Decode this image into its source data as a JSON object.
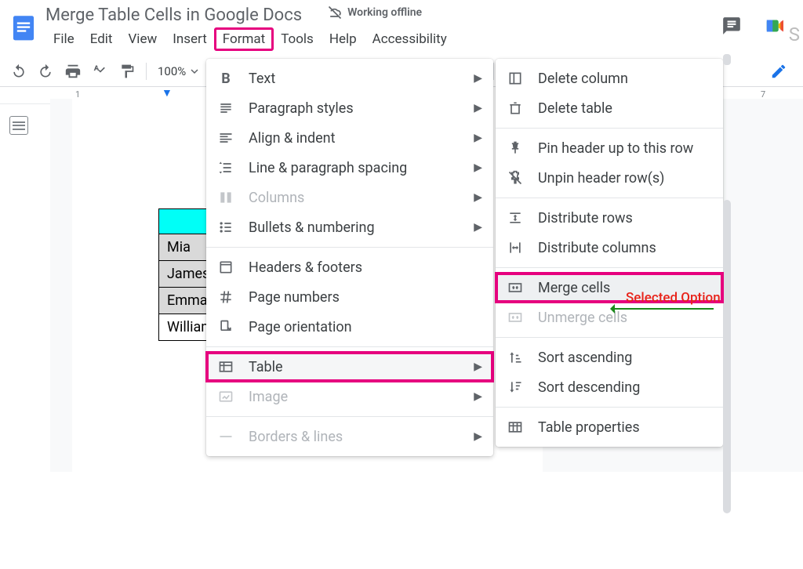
{
  "header": {
    "doc_title": "Merge Table Cells in Google Docs",
    "offline_label": "Working offline"
  },
  "menubar": [
    "File",
    "Edit",
    "View",
    "Insert",
    "Format",
    "Tools",
    "Help",
    "Accessibility"
  ],
  "toolbar": {
    "zoom": "100%"
  },
  "ruler": {
    "ticks": [
      "1",
      "7"
    ]
  },
  "doc_table": {
    "rows": [
      "Mia",
      "James",
      "Emma",
      "William"
    ]
  },
  "format_menu": {
    "items": [
      {
        "icon": "B",
        "label": "Text",
        "sub": true
      },
      {
        "icon": "para",
        "label": "Paragraph styles",
        "sub": true
      },
      {
        "icon": "align",
        "label": "Align & indent",
        "sub": true
      },
      {
        "icon": "spacing",
        "label": "Line & paragraph spacing",
        "sub": true
      },
      {
        "icon": "cols",
        "label": "Columns",
        "sub": true,
        "disabled": true
      },
      {
        "icon": "bullets",
        "label": "Bullets & numbering",
        "sub": true
      },
      {
        "sep": true
      },
      {
        "icon": "hdrftr",
        "label": "Headers & footers"
      },
      {
        "icon": "hash",
        "label": "Page numbers"
      },
      {
        "icon": "orient",
        "label": "Page orientation"
      },
      {
        "sep": true
      },
      {
        "icon": "table",
        "label": "Table",
        "sub": true,
        "highlight": true
      },
      {
        "icon": "image",
        "label": "Image",
        "sub": true,
        "disabled": true
      },
      {
        "sep": true
      },
      {
        "icon": "border",
        "label": "Borders & lines",
        "sub": true,
        "disabled": true
      }
    ]
  },
  "table_submenu": {
    "items": [
      {
        "icon": "delcol",
        "label": "Delete column"
      },
      {
        "icon": "deltbl",
        "label": "Delete table"
      },
      {
        "sep": true
      },
      {
        "icon": "pin",
        "label": "Pin header up to this row"
      },
      {
        "icon": "unpin",
        "label": "Unpin header row(s)"
      },
      {
        "sep": true
      },
      {
        "icon": "distrow",
        "label": "Distribute rows"
      },
      {
        "icon": "distcol",
        "label": "Distribute columns"
      },
      {
        "sep": true
      },
      {
        "icon": "merge",
        "label": "Merge cells",
        "highlight": true,
        "hover": true
      },
      {
        "icon": "unmerge",
        "label": "Unmerge cells",
        "disabled": true
      },
      {
        "sep": true
      },
      {
        "icon": "sortasc",
        "label": "Sort ascending"
      },
      {
        "icon": "sortdesc",
        "label": "Sort descending"
      },
      {
        "sep": true
      },
      {
        "icon": "tblprops",
        "label": "Table properties"
      }
    ]
  },
  "annotation": {
    "label": "Selected Option"
  }
}
